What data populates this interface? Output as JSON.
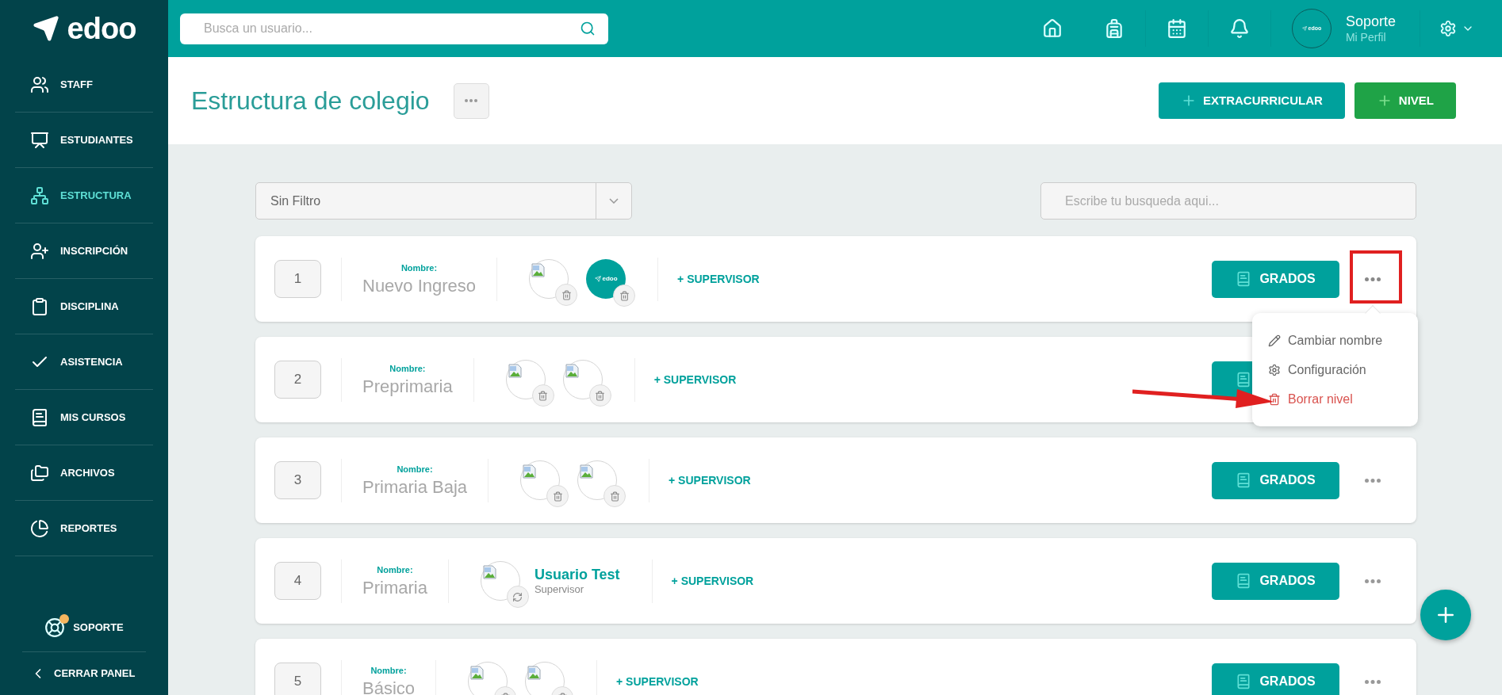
{
  "brand": {
    "name": "edoo"
  },
  "sidebar": {
    "items": [
      {
        "label": "STAFF",
        "selected": false
      },
      {
        "label": "ESTUDIANTES",
        "selected": false
      },
      {
        "label": "ESTRUCTURA",
        "selected": true
      },
      {
        "label": "INSCRIPCIÓN",
        "selected": false
      },
      {
        "label": "DISCIPLINA",
        "selected": false
      },
      {
        "label": "ASISTENCIA",
        "selected": false
      },
      {
        "label": "MIS CURSOS",
        "selected": false
      },
      {
        "label": "ARCHIVOS",
        "selected": false
      },
      {
        "label": "REPORTES",
        "selected": false
      }
    ],
    "support": {
      "label": "SOPORTE",
      "notification": true
    },
    "collapse": {
      "label": "CERRAR PANEL"
    }
  },
  "topbar": {
    "search": {
      "placeholder": "Busca un usuario..."
    },
    "user": {
      "avatar_text": "edoo",
      "name": "Soporte",
      "subtitle": "Mi Perfil"
    }
  },
  "header": {
    "title": "Estructura de colegio",
    "buttons": [
      {
        "label": "EXTRACURRICULAR",
        "kind": "teal"
      },
      {
        "label": "NIVEL",
        "kind": "green"
      }
    ]
  },
  "filter": {
    "value": "Sin Filtro"
  },
  "search": {
    "placeholder": "Escribe tu busqueda aqui..."
  },
  "levels": [
    {
      "number": "1",
      "name_label": "Nombre:",
      "name": "Nuevo Ingreso",
      "supervisors": [
        {
          "kind": "image"
        },
        {
          "kind": "logo",
          "text": "edoo"
        }
      ],
      "add_label": "+ SUPERVISOR",
      "grades_label": "GRADOS",
      "menu_open": true
    },
    {
      "number": "2",
      "name_label": "Nombre:",
      "name": "Preprimaria",
      "supervisors": [
        {
          "kind": "image"
        },
        {
          "kind": "image"
        }
      ],
      "add_label": "+ SUPERVISOR",
      "menu_open": false
    },
    {
      "number": "3",
      "name_label": "Nombre:",
      "name": "Primaria Baja",
      "supervisors": [
        {
          "kind": "image"
        },
        {
          "kind": "image"
        }
      ],
      "add_label": "+ SUPERVISOR",
      "grades_label": "GRADOS",
      "menu_open": false
    },
    {
      "number": "4",
      "name_label": "Nombre:",
      "name": "Primaria",
      "supervisors": [
        {
          "kind": "named",
          "name": "Usuario Test",
          "role": "Supervisor"
        }
      ],
      "add_label": "+ SUPERVISOR",
      "grades_label": "GRADOS",
      "menu_open": false
    },
    {
      "number": "5",
      "name_label": "Nombre:",
      "name": "Básico",
      "supervisors": [
        {
          "kind": "image"
        },
        {
          "kind": "image"
        }
      ],
      "add_label": "+ SUPERVISOR",
      "grades_label": "GRADOS",
      "menu_open": false
    }
  ],
  "menu": {
    "items": [
      {
        "label": "Cambiar nombre",
        "kind": "rename"
      },
      {
        "label": "Configuración",
        "kind": "settings"
      },
      {
        "label": "Borrar nivel",
        "kind": "delete"
      }
    ]
  }
}
